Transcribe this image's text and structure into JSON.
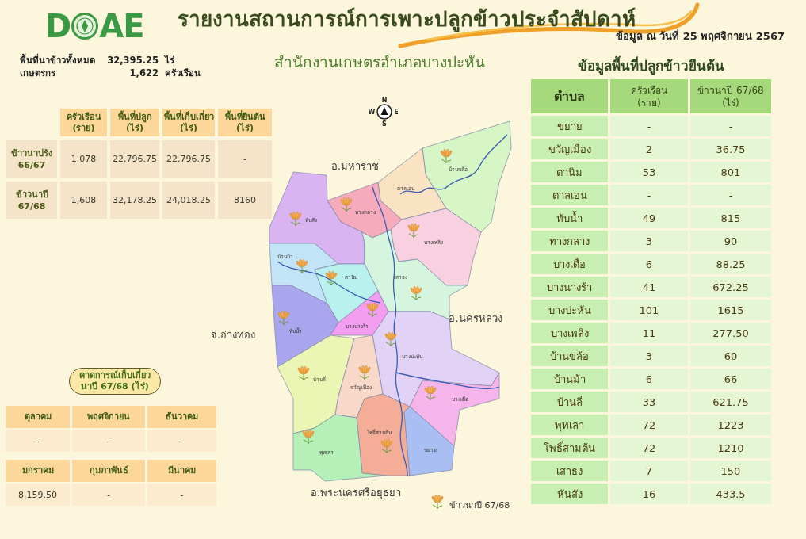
{
  "header": {
    "logo": {
      "left": "D",
      "right": "AE"
    },
    "title": "รายงานสถานการณ์การเพาะปลูกข้าวประจำสัปดาห์",
    "date": "ข้อมูล ณ วันที่ 25 พฤศจิกายน 2567"
  },
  "summary": [
    {
      "label": "พื้นที่นาข้าวทั้งหมด",
      "value": "32,395.25",
      "unit": "ไร่"
    },
    {
      "label": "เกษตรกร",
      "value": "1,622",
      "unit": "ครัวเรือน"
    }
  ],
  "area_table": {
    "columns": [
      "ครัวเรือน\n(ราย)",
      "พื้นที่ปลูก\n(ไร่)",
      "พื้นที่เก็บเกี่ยว\n(ไร่)",
      "พื้นที่ยืนต้น\n(ไร่)"
    ],
    "rows": [
      {
        "label": "ข้าวนาปรัง\n66/67",
        "cells": [
          "1,078",
          "22,796.75",
          "22,796.75",
          "-"
        ]
      },
      {
        "label": "ข้าวนาปี\n67/68",
        "cells": [
          "1,608",
          "32,178.25",
          "24,018.25",
          "8160"
        ]
      }
    ]
  },
  "forecast": {
    "title": "คาดการณ์เก็บเกี่ยว\nนาปี 67/68 (ไร่)",
    "tables": [
      {
        "months": [
          "ตุลาคม",
          "พฤศจิกายน",
          "ธันวาคม"
        ],
        "values": [
          "-",
          "-",
          "-"
        ]
      },
      {
        "months": [
          "มกราคม",
          "กุมภาพันธ์",
          "มีนาคม"
        ],
        "values": [
          "8,159.50",
          "-",
          "-"
        ]
      }
    ]
  },
  "subtitle": "สำนักงานเกษตรอำเภอบางปะหัน",
  "map": {
    "compass": {
      "north": "N",
      "east": "E",
      "south": "S",
      "west": "W"
    },
    "regions": [
      {
        "label": "บ้านขล้อ",
        "color": "#d6f6c6",
        "planted": true
      },
      {
        "label": "ตาลเอน",
        "color": "#fae3c2",
        "planted": false
      },
      {
        "label": "ทางกลาง",
        "color": "#f5abbb",
        "planted": true
      },
      {
        "label": "หันสัง",
        "color": "#d9b3f2",
        "planted": true
      },
      {
        "label": "บางเพลิง",
        "color": "#f8d0e0",
        "planted": true
      },
      {
        "label": "เสาธง",
        "color": "#d6f5de",
        "planted": true
      },
      {
        "label": "บ้านม้า",
        "color": "#c2e4f6",
        "planted": true
      },
      {
        "label": "ตานิม",
        "color": "#b8f1ee",
        "planted": true
      },
      {
        "label": "ทับน้ำ",
        "color": "#aaa6ee",
        "planted": true
      },
      {
        "label": "บางนางร้า",
        "color": "#f39df0",
        "planted": true
      },
      {
        "label": "บางปะหัน",
        "color": "#e2d2f6",
        "planted": true
      },
      {
        "label": "บ้านลี่",
        "color": "#ebf5b4",
        "planted": true
      },
      {
        "label": "ขวัญเมือง",
        "color": "#f8d8c8",
        "planted": true
      },
      {
        "label": "บางเดื่อ",
        "color": "#f5b5ea",
        "planted": true
      },
      {
        "label": "โพธิ์สามต้น",
        "color": "#f4ae98",
        "planted": true
      },
      {
        "label": "ขยาย",
        "color": "#a9bef3",
        "planted": false
      },
      {
        "label": "พุทเลา",
        "color": "#b4f0b8",
        "planted": true
      }
    ],
    "neighbors": [
      "อ.มหาราช",
      "อ.นครหลวง",
      "จ.อ่างทอง",
      "อ.พระนครศรีอยุธยา"
    ],
    "legend": "ข้าวนาปี 67/68"
  },
  "standing_rice": {
    "title": "ข้อมูลพื้นที่ปลูกข้าวยืนต้น",
    "columns": [
      "ตำบล",
      "ครัวเรือน\n(ราย)",
      "ข้าวนาปี 67/68\n(ไร่)"
    ],
    "rows": [
      [
        "ขยาย",
        "-",
        "-"
      ],
      [
        "ขวัญเมือง",
        "2",
        "36.75"
      ],
      [
        "ตานิม",
        "53",
        "801"
      ],
      [
        "ตาลเอน",
        "-",
        "-"
      ],
      [
        "ทับน้ำ",
        "49",
        "815"
      ],
      [
        "ทางกลาง",
        "3",
        "90"
      ],
      [
        "บางเดื่อ",
        "6",
        "88.25"
      ],
      [
        "บางนางร้า",
        "41",
        "672.25"
      ],
      [
        "บางปะหัน",
        "101",
        "1615"
      ],
      [
        "บางเพลิง",
        "11",
        "277.50"
      ],
      [
        "บ้านขล้อ",
        "3",
        "60"
      ],
      [
        "บ้านม้า",
        "6",
        "66"
      ],
      [
        "บ้านลี่",
        "33",
        "621.75"
      ],
      [
        "พุทเลา",
        "72",
        "1223"
      ],
      [
        "โพธิ์สามต้น",
        "72",
        "1210"
      ],
      [
        "เสาธง",
        "7",
        "150"
      ],
      [
        "หันสัง",
        "16",
        "433.5"
      ]
    ]
  }
}
